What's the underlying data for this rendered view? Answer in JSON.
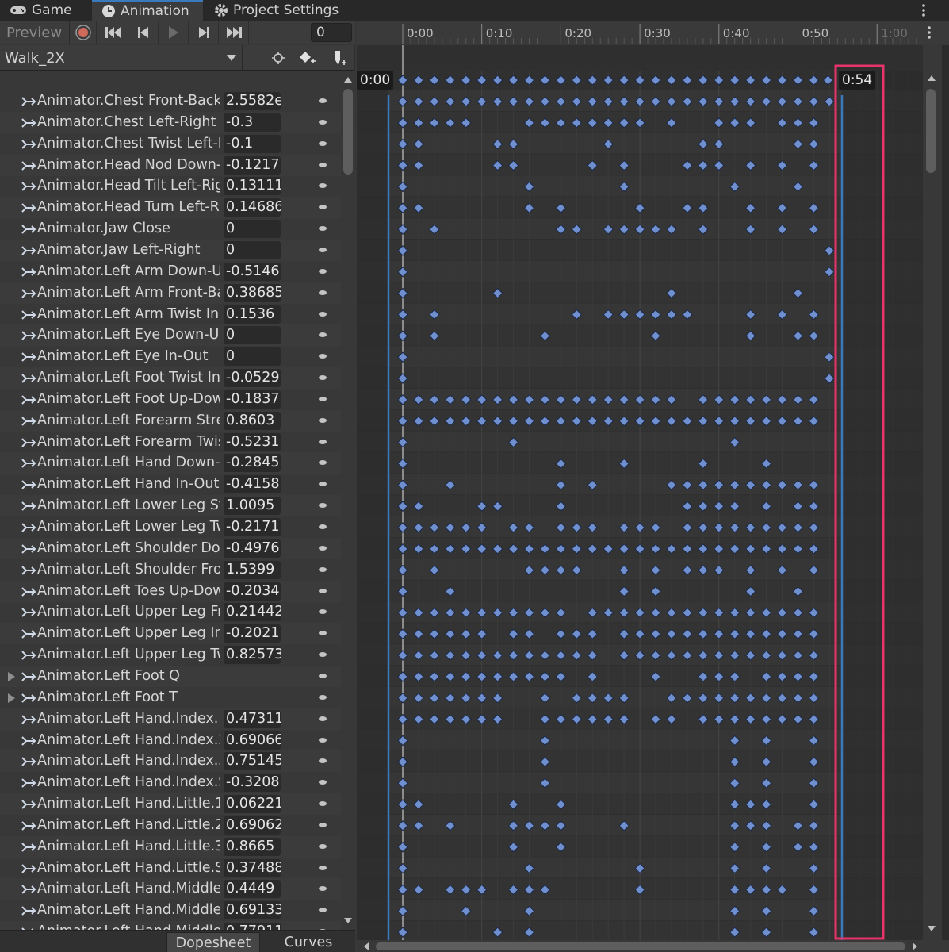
{
  "tabs": [
    {
      "label": "Game",
      "icon": "gamepad-icon"
    },
    {
      "label": "Animation",
      "icon": "clock-icon",
      "active": true
    },
    {
      "label": "Project Settings",
      "icon": "gear-icon"
    }
  ],
  "toolbar": {
    "preview_label": "Preview",
    "frame_value": "0",
    "clip_name": "Walk_2X"
  },
  "timeline": {
    "ruler_labels": [
      "0:00",
      "0:10",
      "0:20",
      "0:30",
      "0:40",
      "0:50",
      "1:00"
    ],
    "start_badge": "0:00",
    "end_badge": "0:54"
  },
  "colors": {
    "accent": "#3a79bb",
    "keyframe": "#6f8fcf",
    "highlight_box": "#e8336b"
  },
  "properties": [
    {
      "name": "Animator.Chest Front-Back",
      "value": "2.5582e"
    },
    {
      "name": "Animator.Chest Left-Right",
      "value": "-0.3"
    },
    {
      "name": "Animator.Chest Twist Left-R",
      "value": "-0.1"
    },
    {
      "name": "Animator.Head Nod Down-U",
      "value": "-0.1217"
    },
    {
      "name": "Animator.Head Tilt Left-Rig",
      "value": "0.13111"
    },
    {
      "name": "Animator.Head Turn Left-Ri",
      "value": "0.14686"
    },
    {
      "name": "Animator.Jaw Close",
      "value": "0"
    },
    {
      "name": "Animator.Jaw Left-Right",
      "value": "0"
    },
    {
      "name": "Animator.Left Arm Down-Up",
      "value": "-0.5146"
    },
    {
      "name": "Animator.Left Arm Front-Ba",
      "value": "0.38685"
    },
    {
      "name": "Animator.Left Arm Twist In-",
      "value": "0.1536"
    },
    {
      "name": "Animator.Left Eye Down-Up",
      "value": "0"
    },
    {
      "name": "Animator.Left Eye In-Out",
      "value": "0"
    },
    {
      "name": "Animator.Left Foot Twist In-",
      "value": "-0.0529"
    },
    {
      "name": "Animator.Left Foot Up-Dow",
      "value": "-0.1837"
    },
    {
      "name": "Animator.Left Forearm Stret",
      "value": "0.8603"
    },
    {
      "name": "Animator.Left Forearm Twis",
      "value": "-0.5231"
    },
    {
      "name": "Animator.Left Hand Down-U",
      "value": "-0.2845"
    },
    {
      "name": "Animator.Left Hand In-Out",
      "value": "-0.4158"
    },
    {
      "name": "Animator.Left Lower Leg Str",
      "value": "1.0095"
    },
    {
      "name": "Animator.Left Lower Leg Tw",
      "value": "-0.2171"
    },
    {
      "name": "Animator.Left Shoulder Dow",
      "value": "-0.4976"
    },
    {
      "name": "Animator.Left Shoulder Fron",
      "value": "1.5399"
    },
    {
      "name": "Animator.Left Toes Up-Dow",
      "value": "-0.2034"
    },
    {
      "name": "Animator.Left Upper Leg Fro",
      "value": "0.21442"
    },
    {
      "name": "Animator.Left Upper Leg In-",
      "value": "-0.2021"
    },
    {
      "name": "Animator.Left Upper Leg Tw",
      "value": "0.82573"
    },
    {
      "name": "Animator.Left Foot Q",
      "value": "",
      "expandable": true
    },
    {
      "name": "Animator.Left Foot T",
      "value": "",
      "expandable": true
    },
    {
      "name": "Animator.Left Hand.Index.1",
      "value": "0.47311"
    },
    {
      "name": "Animator.Left Hand.Index.2",
      "value": "0.69066"
    },
    {
      "name": "Animator.Left Hand.Index.3",
      "value": "0.75145"
    },
    {
      "name": "Animator.Left Hand.Index.Sp",
      "value": "-0.3208"
    },
    {
      "name": "Animator.Left Hand.Little.1 S",
      "value": "0.06221"
    },
    {
      "name": "Animator.Left Hand.Little.2 S",
      "value": "0.69062"
    },
    {
      "name": "Animator.Left Hand.Little.3",
      "value": "0.8665"
    },
    {
      "name": "Animator.Left Hand.Little.Sp",
      "value": "0.37488"
    },
    {
      "name": "Animator.Left Hand.Middle.1",
      "value": "0.4449"
    },
    {
      "name": "Animator.Left Hand.Middle.2",
      "value": "0.69133"
    },
    {
      "name": "Animator.Left Hand.Middle.3",
      "value": "0.77911"
    }
  ],
  "tracks": [
    [
      0,
      2,
      4,
      6,
      8,
      10,
      12,
      14,
      16,
      18,
      20,
      22,
      24,
      26,
      28,
      30,
      32,
      34,
      36,
      38,
      40,
      42,
      44,
      46,
      48,
      50,
      52,
      54
    ],
    [
      0,
      2,
      4,
      6,
      8,
      16,
      18,
      20,
      22,
      24,
      26,
      28,
      30,
      34,
      40,
      42,
      44,
      48,
      50,
      52
    ],
    [
      0,
      2,
      12,
      14,
      26,
      38,
      40,
      50,
      52
    ],
    [
      0,
      2,
      12,
      14,
      24,
      28,
      36,
      38,
      40,
      44,
      48,
      52
    ],
    [
      0,
      16,
      28,
      42,
      50
    ],
    [
      0,
      2,
      16,
      20,
      30,
      36,
      38,
      44,
      48,
      52
    ],
    [
      0,
      4,
      20,
      22,
      26,
      28,
      30,
      32,
      34,
      38,
      44,
      48,
      52
    ],
    [
      0,
      54
    ],
    [
      0,
      54
    ],
    [
      0,
      12,
      34,
      50
    ],
    [
      0,
      4,
      22,
      26,
      28,
      30,
      32,
      34,
      36,
      44,
      48,
      52
    ],
    [
      0,
      4,
      18,
      32,
      44,
      50,
      52
    ],
    [
      0,
      54
    ],
    [
      0,
      54
    ],
    [
      0,
      2,
      4,
      6,
      8,
      10,
      12,
      14,
      16,
      18,
      20,
      22,
      24,
      26,
      28,
      30,
      32,
      34,
      38,
      40,
      42,
      44,
      46,
      48,
      50,
      52
    ],
    [
      0,
      2,
      4,
      6,
      8,
      10,
      12,
      14,
      16,
      18,
      20,
      22,
      24,
      26,
      28,
      30,
      32,
      34,
      36,
      38,
      40,
      42,
      44,
      46,
      48,
      50,
      52
    ],
    [
      0,
      14,
      42
    ],
    [
      0,
      20,
      28,
      38,
      46
    ],
    [
      0,
      6,
      20,
      24,
      34,
      36,
      38,
      40,
      42,
      44,
      46,
      48,
      50,
      52
    ],
    [
      0,
      2,
      10,
      12,
      20,
      36,
      38,
      40,
      42,
      46,
      50,
      52
    ],
    [
      0,
      2,
      4,
      6,
      8,
      10,
      14,
      16,
      20,
      22,
      24,
      28,
      30,
      32,
      36,
      38,
      40,
      42,
      44,
      46,
      48,
      50,
      52
    ],
    [
      0,
      2,
      4,
      6,
      8,
      10,
      12,
      14,
      16,
      18,
      20,
      22,
      24,
      26,
      28,
      30,
      32,
      34,
      36,
      38,
      40,
      42,
      44,
      46,
      48,
      50,
      52
    ],
    [
      0,
      4,
      16,
      18,
      20,
      22,
      28,
      32,
      36,
      38,
      40,
      44,
      48,
      52
    ],
    [
      0,
      6,
      28,
      32,
      44,
      50
    ],
    [
      0,
      2,
      4,
      6,
      8,
      10,
      12,
      14,
      16,
      18,
      20,
      24,
      26,
      28,
      30,
      32,
      34,
      36,
      38,
      40,
      42,
      44,
      46,
      48,
      50,
      52
    ],
    [
      0,
      2,
      4,
      6,
      8,
      10,
      14,
      16,
      20,
      22,
      24,
      28,
      30,
      32,
      34,
      36,
      38,
      40,
      42,
      44,
      46,
      48,
      50,
      52
    ],
    [
      0,
      2,
      4,
      6,
      8,
      10,
      12,
      14,
      16,
      18,
      20,
      22,
      24,
      28,
      30,
      32,
      34,
      36,
      38,
      40,
      42,
      44,
      46,
      48,
      50,
      52
    ],
    [
      0,
      2,
      4,
      6,
      8,
      10,
      12,
      14,
      16,
      18,
      20,
      24,
      32,
      38,
      40,
      42,
      46,
      48,
      50,
      52
    ],
    [
      0,
      2,
      4,
      6,
      8,
      10,
      12,
      18,
      22,
      24,
      26,
      28,
      34,
      36,
      38,
      40,
      42,
      44,
      46,
      48,
      50,
      52
    ],
    [
      0,
      2,
      4,
      6,
      8,
      10,
      12,
      18,
      20,
      22,
      24,
      26,
      28,
      32,
      34,
      38,
      40,
      42,
      44,
      46,
      48,
      50,
      52
    ],
    [
      0,
      18,
      42,
      46,
      52
    ],
    [
      0,
      18,
      42,
      46,
      52
    ],
    [
      0,
      18,
      42,
      46,
      52
    ],
    [
      0,
      2,
      14,
      20,
      42,
      44,
      46,
      52
    ],
    [
      0,
      2,
      6,
      14,
      16,
      18,
      20,
      28,
      42,
      44,
      46,
      50,
      52
    ],
    [
      0,
      14,
      20,
      42,
      46,
      50,
      52
    ],
    [
      0,
      16,
      30,
      42,
      46,
      52
    ],
    [
      0,
      2,
      6,
      8,
      10,
      14,
      16,
      18,
      30,
      42,
      44,
      46,
      48,
      52
    ],
    [
      0,
      8,
      16,
      42,
      46,
      52
    ],
    [
      0,
      12,
      16,
      42,
      46,
      52
    ],
    [
      0,
      14,
      22,
      42,
      46,
      52
    ]
  ]
}
